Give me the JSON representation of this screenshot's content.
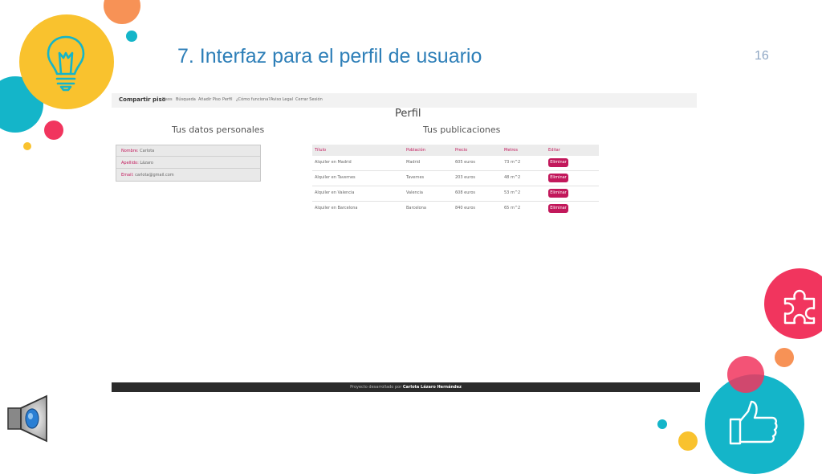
{
  "slide": {
    "title": "7. Interfaz para el perfil de usuario",
    "number": "16"
  },
  "colors": {
    "title_blue": "#2e7fb8",
    "accent_pink": "#c2185b",
    "yellow": "#f9c22e",
    "cyan": "#14b5c9",
    "red_pink": "#f1355e",
    "orange": "#f79256"
  },
  "icons": [
    "lightbulb-icon",
    "puzzle-icon",
    "thumbs-up-icon",
    "speaker-icon"
  ],
  "website": {
    "brand": "Compartir piso",
    "nav": [
      "Pisos",
      "Búsqueda",
      "Añadir Piso",
      "Perfil",
      "¿Cómo funciona?",
      "Aviso Legal",
      "Cerrar Sesión"
    ],
    "page_heading": "Perfil",
    "personal": {
      "heading": "Tus datos personales",
      "rows": [
        {
          "label": "Nombre:",
          "value": "Carlota"
        },
        {
          "label": "Apellido:",
          "value": "Lázaro"
        },
        {
          "label": "Email:",
          "value": "carlota@gmail.com"
        }
      ]
    },
    "publications": {
      "heading": "Tus publicaciones",
      "columns": [
        "Título",
        "Población",
        "Precio",
        "Metros",
        "Editar"
      ],
      "rows": [
        {
          "titulo": "Alquiler en Madrid",
          "poblacion": "Madrid",
          "precio": "605 euros",
          "metros": "73 m^2",
          "action": "Eliminar"
        },
        {
          "titulo": "Alquiler en Tavernes",
          "poblacion": "Tavernes",
          "precio": "203 euros",
          "metros": "48 m^2",
          "action": "Eliminar"
        },
        {
          "titulo": "Alquiler en Valencia",
          "poblacion": "Valencia",
          "precio": "608 euros",
          "metros": "53 m^2",
          "action": "Eliminar"
        },
        {
          "titulo": "Alquiler en Barcelona",
          "poblacion": "Barcelona",
          "precio": "840 euros",
          "metros": "65 m^2",
          "action": "Eliminar"
        }
      ]
    },
    "footer": {
      "prefix": "Proyecto desarrollado por",
      "author": "Carlota Lázaro Hernández"
    }
  }
}
